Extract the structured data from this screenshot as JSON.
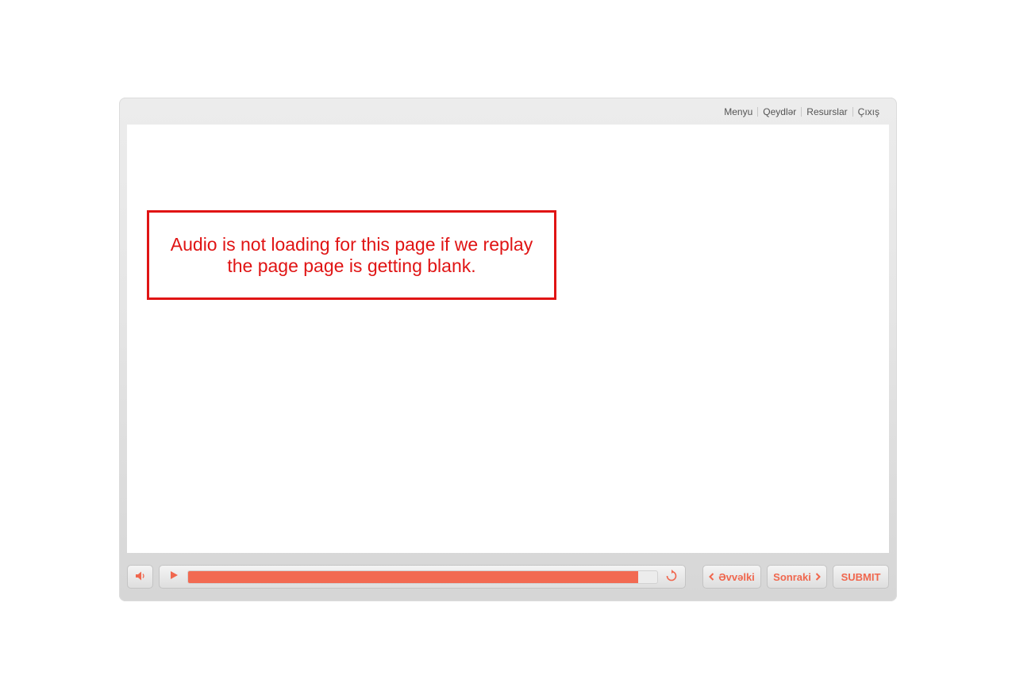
{
  "topnav": {
    "items": [
      "Menyu",
      "Qeydlər",
      "Resurslar",
      "Çıxış"
    ]
  },
  "stage": {
    "note_text": "Audio is not loading for this page if we replay the page page is getting blank."
  },
  "controls": {
    "mute_icon": "speaker-icon",
    "play_icon": "play-icon",
    "replay_icon": "replay-icon",
    "audio_progress_fraction": 0.96,
    "prev_label": "Əvvəlki",
    "next_label": "Sonraki",
    "submit_label": "SUBMIT"
  },
  "colors": {
    "accent": "#f26a52",
    "note_border": "#e01414",
    "frame": "#e6e6e6"
  }
}
